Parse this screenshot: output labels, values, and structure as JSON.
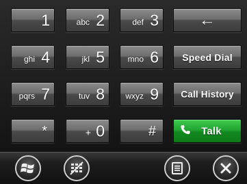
{
  "keypad": {
    "keys": [
      {
        "num": "1",
        "letters": ""
      },
      {
        "num": "2",
        "letters": "abc"
      },
      {
        "num": "3",
        "letters": "def"
      },
      {
        "num": "4",
        "letters": "ghi"
      },
      {
        "num": "5",
        "letters": "jkl"
      },
      {
        "num": "6",
        "letters": "mno"
      },
      {
        "num": "7",
        "letters": "pqrs"
      },
      {
        "num": "8",
        "letters": "tuv"
      },
      {
        "num": "9",
        "letters": "wxyz"
      },
      {
        "num": "*",
        "letters": ""
      },
      {
        "num": "0",
        "letters": "+"
      },
      {
        "num": "#",
        "letters": ""
      }
    ],
    "backspace_glyph": "←",
    "speed_dial_label": "Speed Dial",
    "call_history_label": "Call History",
    "talk_label": "Talk"
  },
  "bottombar": {
    "icons": [
      "windows-start-icon",
      "keypad-hide-icon",
      "menu-icon",
      "close-icon"
    ]
  },
  "colors": {
    "talk_green": "#1ea12e",
    "key_gray": "#6d6d6d",
    "background": "#141414"
  }
}
